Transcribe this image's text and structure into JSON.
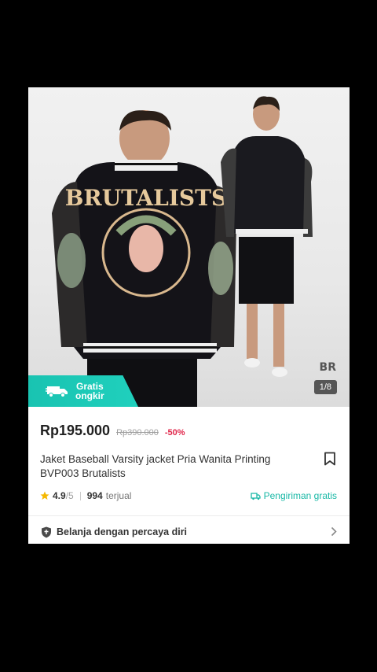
{
  "product": {
    "image_counter": "1/8",
    "shipping_banner": {
      "line1": "Gratis",
      "line2": "ongkir"
    },
    "price": "Rp195.000",
    "original_price": "Rp390.000",
    "discount": "-50%",
    "title": "Jaket Baseball Varsity jacket Pria Wanita Printing BVP003 Brutalists",
    "rating": "4.9",
    "rating_max": "/5",
    "sold_count": "994",
    "sold_label": "terjual",
    "free_shipping": "Pengiriman gratis",
    "jacket_print": "BRUTALISTS"
  },
  "trust": {
    "label": "Belanja dengan percaya diri"
  },
  "colors": {
    "accent": "#19c3b1",
    "discount": "#e0264a",
    "rating_star": "#f5b800"
  }
}
